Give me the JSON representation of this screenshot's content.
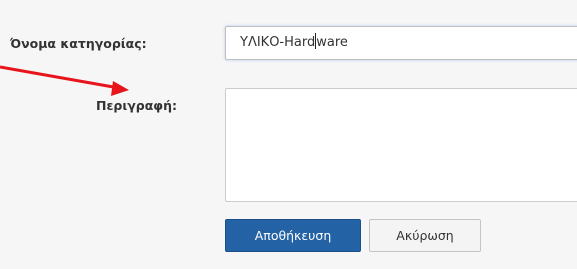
{
  "form": {
    "category_name_label": "Όνομα κατηγορίας:",
    "category_name_value_before_caret": "ΥΛΙΚΟ-Hard",
    "category_name_value_after_caret": "ware",
    "description_label": "Περιγραφή:",
    "description_value": ""
  },
  "buttons": {
    "save_label": "Αποθήκευση",
    "cancel_label": "Ακύρωση"
  },
  "colors": {
    "save_button": "#2462a6",
    "annotation_arrow": "#e8141c",
    "background": "#f6f6f6"
  }
}
